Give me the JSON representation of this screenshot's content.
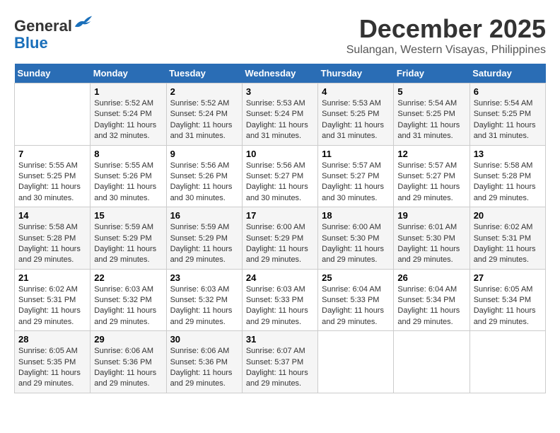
{
  "header": {
    "logo_line1": "General",
    "logo_line2": "Blue",
    "month": "December 2025",
    "location": "Sulangan, Western Visayas, Philippines"
  },
  "days_of_week": [
    "Sunday",
    "Monday",
    "Tuesday",
    "Wednesday",
    "Thursday",
    "Friday",
    "Saturday"
  ],
  "weeks": [
    [
      {
        "day": "",
        "info": ""
      },
      {
        "day": "1",
        "info": "Sunrise: 5:52 AM\nSunset: 5:24 PM\nDaylight: 11 hours\nand 32 minutes."
      },
      {
        "day": "2",
        "info": "Sunrise: 5:52 AM\nSunset: 5:24 PM\nDaylight: 11 hours\nand 31 minutes."
      },
      {
        "day": "3",
        "info": "Sunrise: 5:53 AM\nSunset: 5:24 PM\nDaylight: 11 hours\nand 31 minutes."
      },
      {
        "day": "4",
        "info": "Sunrise: 5:53 AM\nSunset: 5:25 PM\nDaylight: 11 hours\nand 31 minutes."
      },
      {
        "day": "5",
        "info": "Sunrise: 5:54 AM\nSunset: 5:25 PM\nDaylight: 11 hours\nand 31 minutes."
      },
      {
        "day": "6",
        "info": "Sunrise: 5:54 AM\nSunset: 5:25 PM\nDaylight: 11 hours\nand 31 minutes."
      }
    ],
    [
      {
        "day": "7",
        "info": "Sunrise: 5:55 AM\nSunset: 5:25 PM\nDaylight: 11 hours\nand 30 minutes."
      },
      {
        "day": "8",
        "info": "Sunrise: 5:55 AM\nSunset: 5:26 PM\nDaylight: 11 hours\nand 30 minutes."
      },
      {
        "day": "9",
        "info": "Sunrise: 5:56 AM\nSunset: 5:26 PM\nDaylight: 11 hours\nand 30 minutes."
      },
      {
        "day": "10",
        "info": "Sunrise: 5:56 AM\nSunset: 5:27 PM\nDaylight: 11 hours\nand 30 minutes."
      },
      {
        "day": "11",
        "info": "Sunrise: 5:57 AM\nSunset: 5:27 PM\nDaylight: 11 hours\nand 30 minutes."
      },
      {
        "day": "12",
        "info": "Sunrise: 5:57 AM\nSunset: 5:27 PM\nDaylight: 11 hours\nand 29 minutes."
      },
      {
        "day": "13",
        "info": "Sunrise: 5:58 AM\nSunset: 5:28 PM\nDaylight: 11 hours\nand 29 minutes."
      }
    ],
    [
      {
        "day": "14",
        "info": "Sunrise: 5:58 AM\nSunset: 5:28 PM\nDaylight: 11 hours\nand 29 minutes."
      },
      {
        "day": "15",
        "info": "Sunrise: 5:59 AM\nSunset: 5:29 PM\nDaylight: 11 hours\nand 29 minutes."
      },
      {
        "day": "16",
        "info": "Sunrise: 5:59 AM\nSunset: 5:29 PM\nDaylight: 11 hours\nand 29 minutes."
      },
      {
        "day": "17",
        "info": "Sunrise: 6:00 AM\nSunset: 5:29 PM\nDaylight: 11 hours\nand 29 minutes."
      },
      {
        "day": "18",
        "info": "Sunrise: 6:00 AM\nSunset: 5:30 PM\nDaylight: 11 hours\nand 29 minutes."
      },
      {
        "day": "19",
        "info": "Sunrise: 6:01 AM\nSunset: 5:30 PM\nDaylight: 11 hours\nand 29 minutes."
      },
      {
        "day": "20",
        "info": "Sunrise: 6:02 AM\nSunset: 5:31 PM\nDaylight: 11 hours\nand 29 minutes."
      }
    ],
    [
      {
        "day": "21",
        "info": "Sunrise: 6:02 AM\nSunset: 5:31 PM\nDaylight: 11 hours\nand 29 minutes."
      },
      {
        "day": "22",
        "info": "Sunrise: 6:03 AM\nSunset: 5:32 PM\nDaylight: 11 hours\nand 29 minutes."
      },
      {
        "day": "23",
        "info": "Sunrise: 6:03 AM\nSunset: 5:32 PM\nDaylight: 11 hours\nand 29 minutes."
      },
      {
        "day": "24",
        "info": "Sunrise: 6:03 AM\nSunset: 5:33 PM\nDaylight: 11 hours\nand 29 minutes."
      },
      {
        "day": "25",
        "info": "Sunrise: 6:04 AM\nSunset: 5:33 PM\nDaylight: 11 hours\nand 29 minutes."
      },
      {
        "day": "26",
        "info": "Sunrise: 6:04 AM\nSunset: 5:34 PM\nDaylight: 11 hours\nand 29 minutes."
      },
      {
        "day": "27",
        "info": "Sunrise: 6:05 AM\nSunset: 5:34 PM\nDaylight: 11 hours\nand 29 minutes."
      }
    ],
    [
      {
        "day": "28",
        "info": "Sunrise: 6:05 AM\nSunset: 5:35 PM\nDaylight: 11 hours\nand 29 minutes."
      },
      {
        "day": "29",
        "info": "Sunrise: 6:06 AM\nSunset: 5:36 PM\nDaylight: 11 hours\nand 29 minutes."
      },
      {
        "day": "30",
        "info": "Sunrise: 6:06 AM\nSunset: 5:36 PM\nDaylight: 11 hours\nand 29 minutes."
      },
      {
        "day": "31",
        "info": "Sunrise: 6:07 AM\nSunset: 5:37 PM\nDaylight: 11 hours\nand 29 minutes."
      },
      {
        "day": "",
        "info": ""
      },
      {
        "day": "",
        "info": ""
      },
      {
        "day": "",
        "info": ""
      }
    ]
  ]
}
